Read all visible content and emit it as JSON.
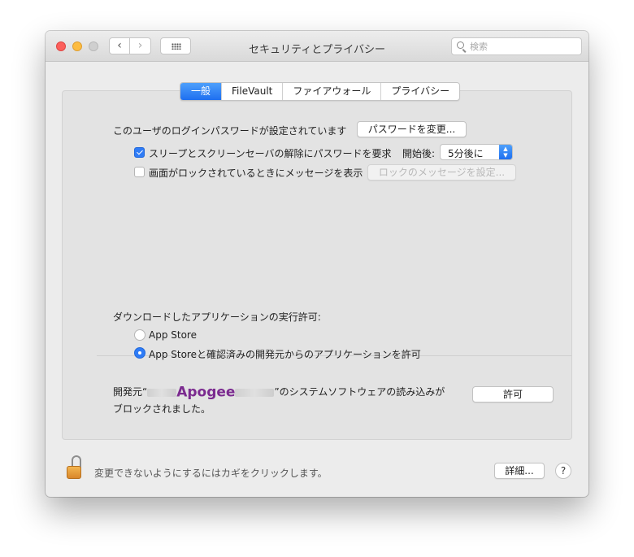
{
  "window": {
    "title": "セキュリティとプライバシー",
    "back_glyph": "‹",
    "forward_glyph": "›",
    "search_placeholder": "検索"
  },
  "tabs": [
    {
      "label": "一般",
      "active": true
    },
    {
      "label": "FileVault",
      "active": false
    },
    {
      "label": "ファイアウォール",
      "active": false
    },
    {
      "label": "プライバシー",
      "active": false
    }
  ],
  "general": {
    "login_password_text": "このユーザのログインパスワードが設定されています",
    "change_password_button": "パスワードを変更...",
    "require_password_label": "スリープとスクリーンセーバの解除にパスワードを要求",
    "require_password_checked": true,
    "after_label": "開始後:",
    "delay_value": "5分後に",
    "show_message_label": "画面がロックされているときにメッセージを表示",
    "show_message_checked": false,
    "set_message_button": "ロックのメッセージを設定..."
  },
  "downloads": {
    "heading": "ダウンロードしたアプリケーションの実行許可:",
    "options": [
      {
        "label": "App Store",
        "selected": false
      },
      {
        "label": "App Storeと確認済みの開発元からのアプリケーションを許可",
        "selected": true
      }
    ],
    "blocked_prefix": "開発元“",
    "developer_name": "Apogee",
    "blocked_suffix": "”のシステムソフトウェアの読み込みが",
    "blocked_line2": "ブロックされました。",
    "allow_button": "許可"
  },
  "footer": {
    "lock_text": "変更できないようにするにはカギをクリックします。",
    "advanced_button": "詳細...",
    "help_glyph": "?"
  },
  "colors": {
    "accent": "#2f7cf6",
    "developer_highlight": "#7b2a8f",
    "lock": "#e69a35"
  }
}
